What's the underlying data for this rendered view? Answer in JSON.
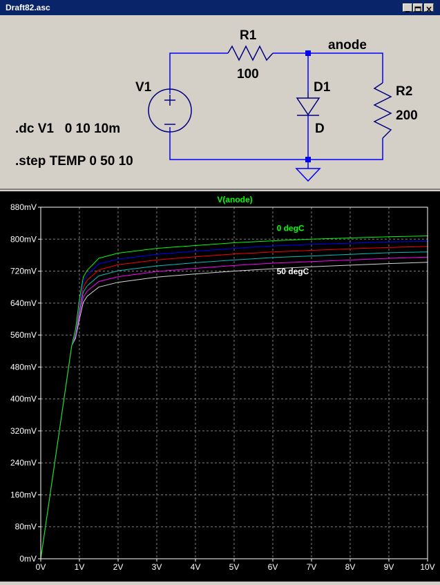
{
  "window": {
    "title": "Draft82.asc"
  },
  "schematic": {
    "r1": {
      "name": "R1",
      "value": "100"
    },
    "r2": {
      "name": "R2",
      "value": "200"
    },
    "v1": {
      "name": "V1"
    },
    "d1": {
      "name": "D1",
      "model": "D"
    },
    "net_label": "anode",
    "directive_dc": ".dc V1   0 10 10m",
    "directive_step": ".step TEMP 0 50 10"
  },
  "colors": {
    "wire": "#0000ff",
    "component": "#000080",
    "background": "#d4d0c8",
    "plot_bg": "#000000",
    "grid": "#7f7f7f"
  },
  "chart_data": {
    "type": "line",
    "title": "V(anode)",
    "xlabel": "",
    "ylabel": "",
    "xlim": [
      0,
      10
    ],
    "ylim": [
      0,
      880
    ],
    "x_ticks": [
      "0V",
      "1V",
      "2V",
      "3V",
      "4V",
      "5V",
      "6V",
      "7V",
      "8V",
      "9V",
      "10V"
    ],
    "y_ticks": [
      "0mV",
      "80mV",
      "160mV",
      "240mV",
      "320mV",
      "400mV",
      "480mV",
      "560mV",
      "640mV",
      "720mV",
      "800mV",
      "880mV"
    ],
    "x_unit": "V",
    "y_unit": "mV",
    "grid": true,
    "annotations": [
      {
        "text": "0 degC",
        "x": 6.1,
        "y": 820,
        "color": "#00ff00"
      },
      {
        "text": "50 degC",
        "x": 6.1,
        "y": 712,
        "color": "#ffffff"
      }
    ],
    "series": [
      {
        "color": "#00ff00",
        "x": [
          0,
          0.5,
          0.8,
          0.9,
          1.0,
          1.1,
          1.2,
          1.5,
          2,
          3,
          4,
          5,
          6,
          7,
          8,
          9,
          10
        ],
        "y": [
          0,
          333,
          533,
          575,
          650,
          705,
          722,
          752,
          765,
          777,
          784,
          791,
          796,
          800,
          803,
          806,
          808
        ]
      },
      {
        "color": "#0000ff",
        "x": [
          0,
          0.5,
          0.8,
          0.9,
          1.0,
          1.1,
          1.2,
          1.5,
          2,
          3,
          4,
          5,
          6,
          7,
          8,
          9,
          10
        ],
        "y": [
          0,
          333,
          533,
          570,
          640,
          693,
          710,
          738,
          750,
          762,
          770,
          777,
          783,
          787,
          790,
          793,
          795
        ]
      },
      {
        "color": "#ff0000",
        "x": [
          0,
          0.5,
          0.8,
          0.9,
          1.0,
          1.1,
          1.2,
          1.5,
          2,
          3,
          4,
          5,
          6,
          7,
          8,
          9,
          10
        ],
        "y": [
          0,
          333,
          533,
          565,
          630,
          680,
          697,
          723,
          736,
          748,
          756,
          763,
          768,
          772,
          776,
          779,
          782
        ]
      },
      {
        "color": "#00c0c0",
        "x": [
          0,
          0.5,
          0.8,
          0.9,
          1.0,
          1.1,
          1.2,
          1.5,
          2,
          3,
          4,
          5,
          6,
          7,
          8,
          9,
          10
        ],
        "y": [
          0,
          333,
          533,
          560,
          620,
          668,
          683,
          708,
          721,
          733,
          741,
          748,
          754,
          758,
          762,
          766,
          768
        ]
      },
      {
        "color": "#ff00ff",
        "x": [
          0,
          0.5,
          0.8,
          0.9,
          1.0,
          1.1,
          1.2,
          1.5,
          2,
          3,
          4,
          5,
          6,
          7,
          8,
          9,
          10
        ],
        "y": [
          0,
          333,
          533,
          556,
          610,
          655,
          670,
          694,
          706,
          719,
          727,
          734,
          740,
          744,
          748,
          752,
          755
        ]
      },
      {
        "color": "#d8d8d8",
        "x": [
          0,
          0.5,
          0.8,
          0.9,
          1.0,
          1.1,
          1.2,
          1.5,
          2,
          3,
          4,
          5,
          6,
          7,
          8,
          9,
          10
        ],
        "y": [
          0,
          333,
          533,
          552,
          600,
          642,
          657,
          680,
          692,
          705,
          713,
          720,
          726,
          731,
          735,
          739,
          742
        ]
      }
    ]
  }
}
